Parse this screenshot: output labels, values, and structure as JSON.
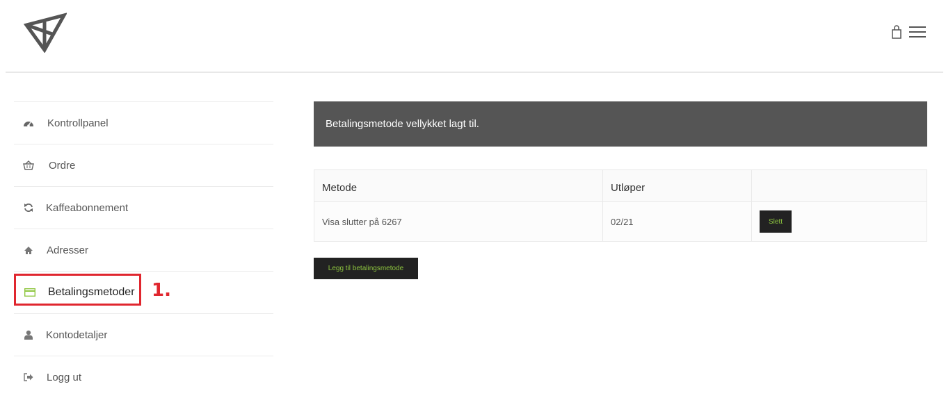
{
  "header": {
    "logo_icon": "triangle-logo-icon",
    "cart_icon": "shopping-bag-icon",
    "menu_icon": "hamburger-menu-icon"
  },
  "sidebar": {
    "items": [
      {
        "label": "Kontrollpanel",
        "icon": "dashboard-icon"
      },
      {
        "label": "Ordre",
        "icon": "basket-icon"
      },
      {
        "label": "Kaffeabonnement",
        "icon": "refresh-icon"
      },
      {
        "label": "Adresser",
        "icon": "home-icon"
      },
      {
        "label": "Betalingsmetoder",
        "icon": "credit-card-icon",
        "active": true
      },
      {
        "label": "Kontodetaljer",
        "icon": "user-icon"
      },
      {
        "label": "Logg ut",
        "icon": "sign-out-icon"
      }
    ],
    "annotation": "1."
  },
  "main": {
    "notice": "Betalingsmetode vellykket lagt til.",
    "table": {
      "headers": [
        "Metode",
        "Utløper",
        ""
      ],
      "rows": [
        {
          "method": "Visa slutter på 6267",
          "expires": "02/21",
          "action": "Slett"
        }
      ]
    },
    "add_button": "Legg til betalingsmetode"
  },
  "colors": {
    "accent_text": "#8ec63f",
    "highlight": "#e0262e",
    "notice_bg": "#555555",
    "button_bg": "#222222"
  }
}
